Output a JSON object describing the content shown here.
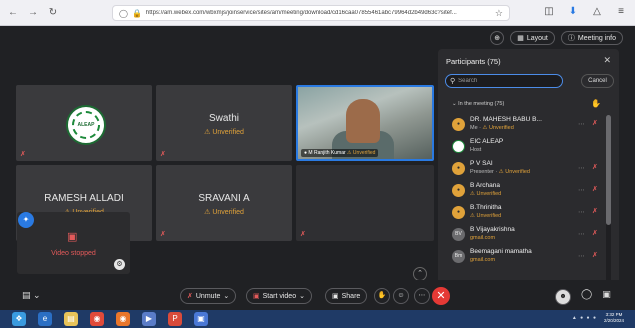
{
  "browser": {
    "url": "https://am.webex.com/wbxmjs/joinservice/sites/am/meeting/download/cd16caa07855461abc79964d2b49d63c?sitef...",
    "icons": {
      "back": "arrow-left-icon",
      "forward": "arrow-right-icon",
      "reload": "reload-icon"
    }
  },
  "topbar": {
    "layout_label": "Layout",
    "meeting_info_label": "Meeting info"
  },
  "tiles": {
    "aleap": {
      "logo_text": "ALEAP"
    },
    "swathi": {
      "name": "Swathi",
      "status": "Unverified"
    },
    "video": {
      "name": "M Ranjith Kumar",
      "status": "Unverified"
    },
    "ramesh": {
      "name": "RAMESH ALLADI",
      "status": "Unverified"
    },
    "sravani": {
      "name": "SRAVANI A",
      "status": "Unverified"
    }
  },
  "selfview": {
    "status": "Video stopped"
  },
  "participants": {
    "title": "Participants (75)",
    "search_placeholder": "Search",
    "cancel_label": "Cancel",
    "section_label": "In the meeting (75)",
    "items": [
      {
        "initials": "",
        "name": "DR. MAHESH BABU B...",
        "sub1": "Me",
        "sub2": "Unverified"
      },
      {
        "initials": "",
        "name": "EIC ALEAP",
        "sub1": "Host",
        "sub2": ""
      },
      {
        "initials": "",
        "name": "P V SAI",
        "sub1": "Presenter",
        "sub2": "Unverified"
      },
      {
        "initials": "",
        "name": "B Archana",
        "sub1": "",
        "sub2": "Unverified"
      },
      {
        "initials": "",
        "name": "B.Thrinitha",
        "sub1": "",
        "sub2": "Unverified"
      },
      {
        "initials": "BV",
        "name": "B Vijayakrishna",
        "sub1": "",
        "sub2": "gmail.com"
      },
      {
        "initials": "Bm",
        "name": "Beemagani mamatha",
        "sub1": "",
        "sub2": "gmail.com"
      }
    ]
  },
  "toolbar": {
    "unmute_label": "Unmute",
    "start_video_label": "Start video",
    "share_label": "Share"
  },
  "taskbar": {
    "time": "3:32 PM",
    "date": "2/20/2024"
  }
}
